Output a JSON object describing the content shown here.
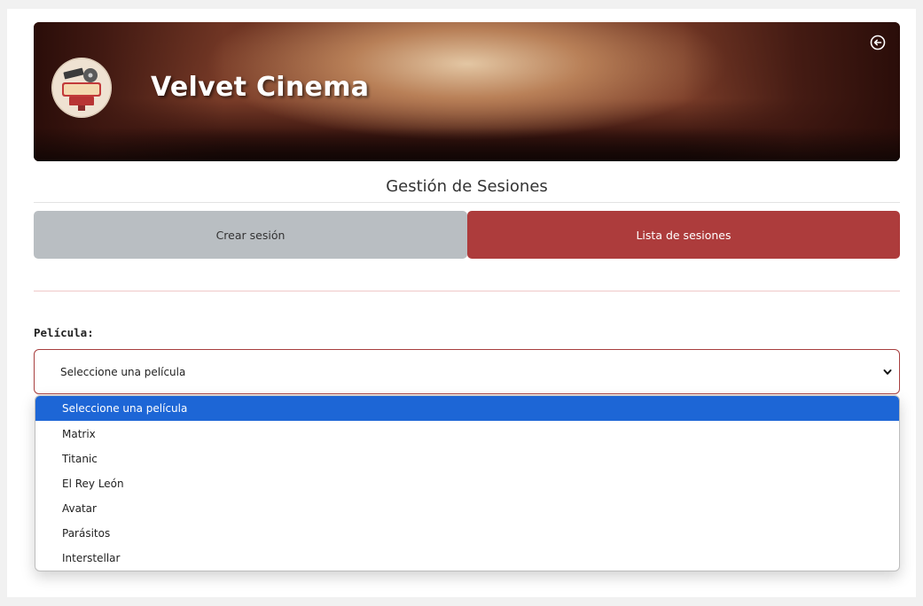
{
  "header": {
    "brand": "Velvet Cinema",
    "logo_icon": "cinema-logo",
    "logout_icon": "logout-icon"
  },
  "section_title": "Gestión de Sesiones",
  "tabs": {
    "create": "Crear sesión",
    "list": "Lista de sesiones"
  },
  "form": {
    "movie_label": "Película:",
    "movie_select": {
      "value": "Seleccione una película",
      "options": [
        "Seleccione una película",
        "Matrix",
        "Titanic",
        "El Rey León",
        "Avatar",
        "Parásitos",
        "Interstellar"
      ],
      "selected_index": 0
    }
  },
  "colors": {
    "accent": "#ad3c3c",
    "tab_inactive": "#b9bec2",
    "option_highlight": "#1d66d6"
  }
}
